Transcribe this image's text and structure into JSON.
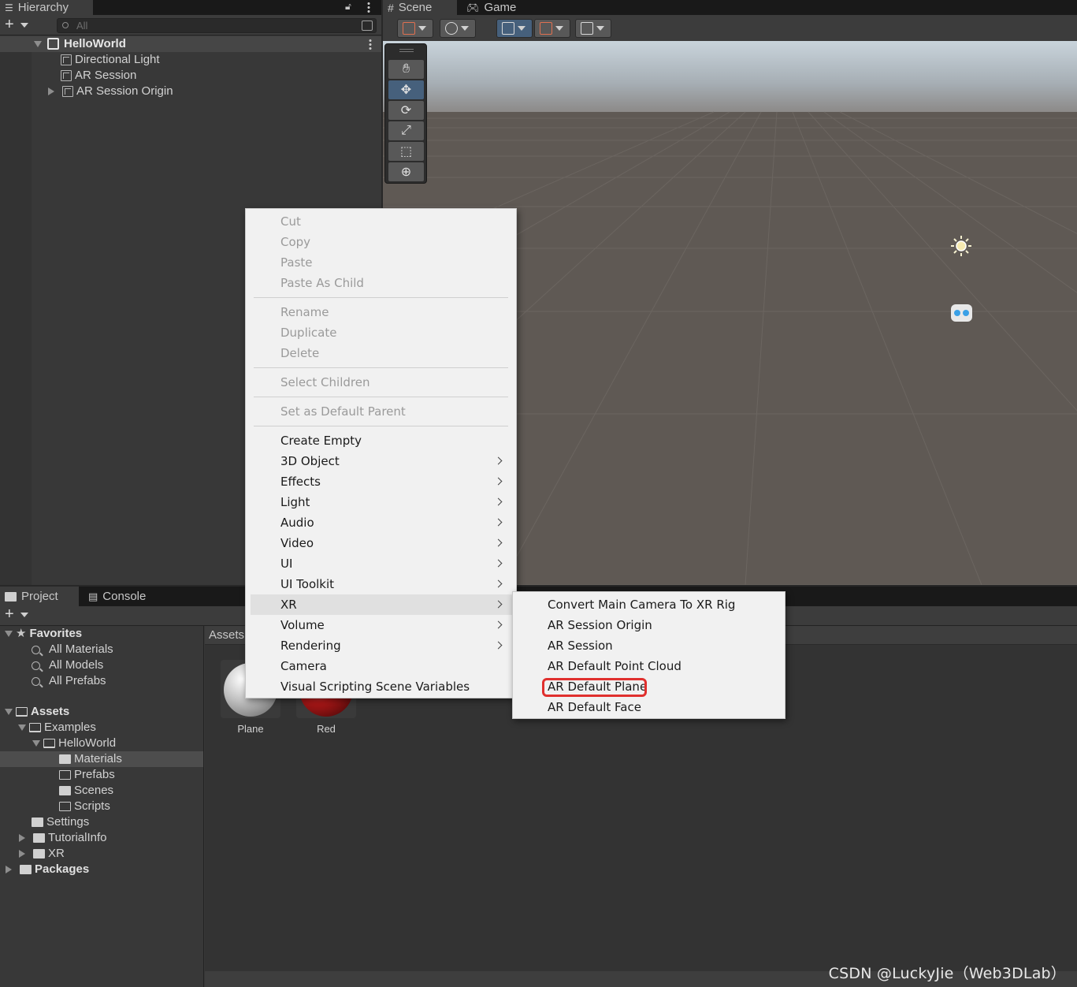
{
  "hierarchy": {
    "tab_label": "Hierarchy",
    "search_placeholder": "All",
    "scene_name": "HelloWorld",
    "items": [
      {
        "label": "Directional Light"
      },
      {
        "label": "AR Session"
      },
      {
        "label": "AR Session Origin"
      }
    ]
  },
  "scene_view": {
    "tabs": [
      {
        "label": "Scene"
      },
      {
        "label": "Game"
      }
    ],
    "tools": [
      "hand-tool",
      "move-tool",
      "rotate-tool",
      "scale-tool",
      "rect-tool",
      "transform-tool"
    ]
  },
  "project": {
    "tabs": [
      {
        "label": "Project"
      },
      {
        "label": "Console"
      }
    ],
    "breadcrumb": "Assets",
    "favorites": {
      "label": "Favorites",
      "items": [
        "All Materials",
        "All Models",
        "All Prefabs"
      ]
    },
    "assets_tree": {
      "root": "Assets",
      "examples": "Examples",
      "helloworld": "HelloWorld",
      "materials": "Materials",
      "prefabs": "Prefabs",
      "scenes": "Scenes",
      "scripts": "Scripts",
      "settings": "Settings",
      "tutorialinfo": "TutorialInfo",
      "xr": "XR",
      "packages": "Packages"
    },
    "assets": [
      {
        "label": "Plane",
        "color": "#d8d8d8"
      },
      {
        "label": "Red",
        "color": "#b01818"
      }
    ]
  },
  "context_menu": {
    "group1": [
      "Cut",
      "Copy",
      "Paste",
      "Paste As Child"
    ],
    "group2": [
      "Rename",
      "Duplicate",
      "Delete"
    ],
    "group3": [
      "Select Children"
    ],
    "group4": [
      "Set as Default Parent"
    ],
    "group5": [
      "Create Empty",
      "3D Object",
      "Effects",
      "Light",
      "Audio",
      "Video",
      "UI",
      "UI Toolkit",
      "XR",
      "Volume",
      "Rendering",
      "Camera",
      "Visual Scripting Scene Variables"
    ]
  },
  "xr_submenu": [
    "Convert Main Camera To XR Rig",
    "AR Session Origin",
    "AR Session",
    "AR Default Point Cloud",
    "AR Default Plane",
    "AR Default Face"
  ],
  "watermark": "CSDN @LuckyJie（Web3DLab）",
  "colors": {
    "highlight_box": "#e0302e",
    "selection_blue": "#46607c"
  }
}
